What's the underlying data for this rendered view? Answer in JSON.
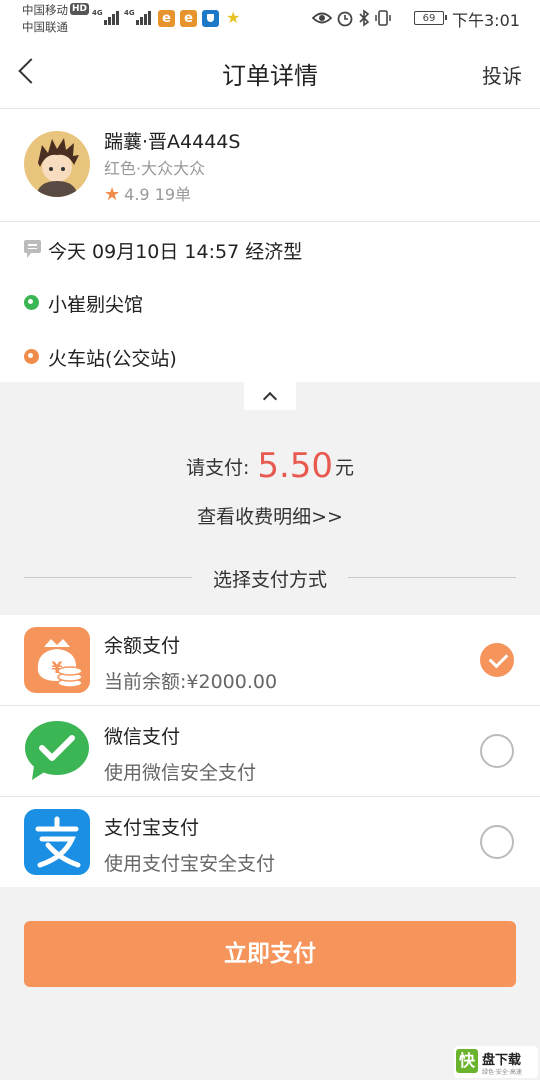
{
  "status": {
    "carrier1": "中国移动",
    "carrier2": "中国联通",
    "hd": "HD",
    "net1": "4G",
    "net2": "4G",
    "battery": "69",
    "time": "下午3:01",
    "icons": [
      "eye-icon",
      "alarm-icon",
      "bluetooth-icon",
      "vibrate-icon"
    ]
  },
  "nav": {
    "title": "订单详情",
    "complain": "投诉"
  },
  "driver": {
    "name": "踹蘘·晋A4444S",
    "car": "红色·大众大众",
    "rating": "4.9",
    "orders": "19单"
  },
  "trip": {
    "time_line": "今天 09月10日 14:57 经济型",
    "start": "小崔剔尖馆",
    "end": "火车站(公交站)"
  },
  "payment": {
    "prompt": "请支付:",
    "amount": "5.50",
    "unit": "元",
    "detail_link": "查看收费明细>>",
    "choose_label": "选择支付方式",
    "methods": [
      {
        "name": "余额支付",
        "sub": "当前余额:¥2000.00",
        "selected": true
      },
      {
        "name": "微信支付",
        "sub": "使用微信安全支付",
        "selected": false
      },
      {
        "name": "支付宝支付",
        "sub": "使用支付宝安全支付",
        "selected": false
      }
    ],
    "pay_button": "立即支付"
  },
  "watermark": {
    "logo_char": "快",
    "title": "盘下载",
    "sub": "绿色·安全·高速"
  },
  "colors": {
    "accent": "#f5955c",
    "price": "#e85a4f",
    "wechat": "#3cb554",
    "alipay": "#1a8fe3"
  }
}
